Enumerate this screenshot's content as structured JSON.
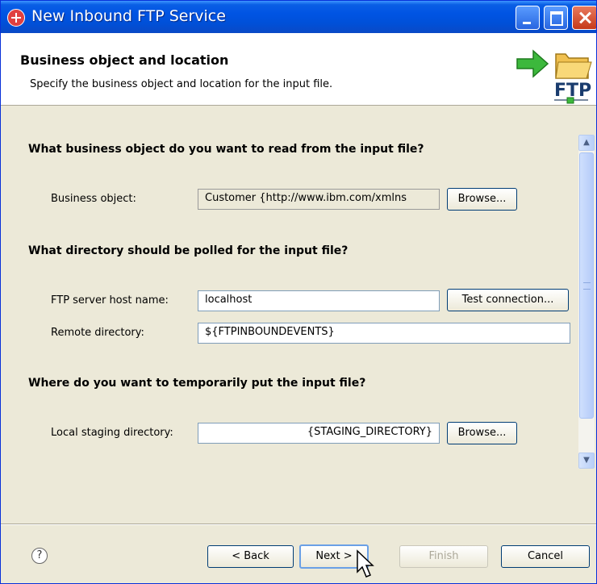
{
  "window": {
    "title": "New Inbound FTP Service"
  },
  "header": {
    "title": "Business object and location",
    "description": "Specify the business object and location for the input file.",
    "logo_text": "FTP"
  },
  "sections": {
    "business_object": {
      "question": "What business object do you want to read from the input file?",
      "label": "Business object:",
      "value": "Customer  {http://www.ibm.com/xmlns",
      "browse_label": "Browse..."
    },
    "directory": {
      "question": "What directory should be polled for the input file?",
      "host_label": "FTP server host name:",
      "host_value": "localhost",
      "test_label": "Test connection...",
      "remote_label": "Remote directory:",
      "remote_value": "${FTPINBOUNDEVENTS}"
    },
    "staging": {
      "question": "Where do you want to temporarily put the input file?",
      "label": "Local staging directory:",
      "value": "{STAGING_DIRECTORY}",
      "browse_label": "Browse..."
    }
  },
  "footer": {
    "help_symbol": "?",
    "back_label": "< Back",
    "next_label": "Next >",
    "finish_label": "Finish",
    "cancel_label": "Cancel"
  },
  "colors": {
    "titlebar": "#0054e3",
    "dialog_bg": "#ece9d8",
    "accent_green": "#3cb83c",
    "folder": "#f0c050"
  }
}
